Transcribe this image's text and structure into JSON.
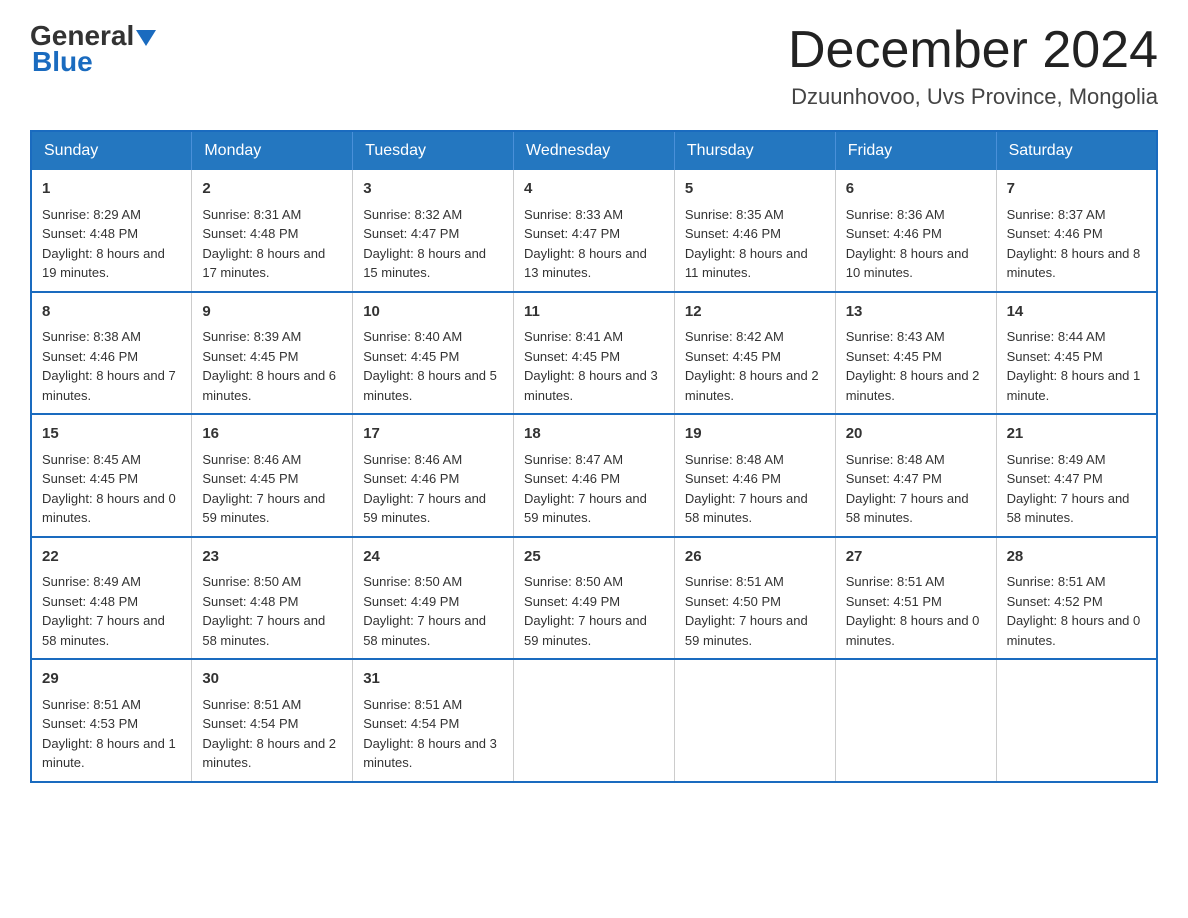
{
  "header": {
    "logo": {
      "general": "General",
      "blue": "Blue",
      "url_text": "GeneralBlue"
    },
    "title": "December 2024",
    "location": "Dzuunhovoo, Uvs Province, Mongolia"
  },
  "days_of_week": [
    "Sunday",
    "Monday",
    "Tuesday",
    "Wednesday",
    "Thursday",
    "Friday",
    "Saturday"
  ],
  "weeks": [
    [
      {
        "day": "1",
        "sunrise": "Sunrise: 8:29 AM",
        "sunset": "Sunset: 4:48 PM",
        "daylight": "Daylight: 8 hours and 19 minutes."
      },
      {
        "day": "2",
        "sunrise": "Sunrise: 8:31 AM",
        "sunset": "Sunset: 4:48 PM",
        "daylight": "Daylight: 8 hours and 17 minutes."
      },
      {
        "day": "3",
        "sunrise": "Sunrise: 8:32 AM",
        "sunset": "Sunset: 4:47 PM",
        "daylight": "Daylight: 8 hours and 15 minutes."
      },
      {
        "day": "4",
        "sunrise": "Sunrise: 8:33 AM",
        "sunset": "Sunset: 4:47 PM",
        "daylight": "Daylight: 8 hours and 13 minutes."
      },
      {
        "day": "5",
        "sunrise": "Sunrise: 8:35 AM",
        "sunset": "Sunset: 4:46 PM",
        "daylight": "Daylight: 8 hours and 11 minutes."
      },
      {
        "day": "6",
        "sunrise": "Sunrise: 8:36 AM",
        "sunset": "Sunset: 4:46 PM",
        "daylight": "Daylight: 8 hours and 10 minutes."
      },
      {
        "day": "7",
        "sunrise": "Sunrise: 8:37 AM",
        "sunset": "Sunset: 4:46 PM",
        "daylight": "Daylight: 8 hours and 8 minutes."
      }
    ],
    [
      {
        "day": "8",
        "sunrise": "Sunrise: 8:38 AM",
        "sunset": "Sunset: 4:46 PM",
        "daylight": "Daylight: 8 hours and 7 minutes."
      },
      {
        "day": "9",
        "sunrise": "Sunrise: 8:39 AM",
        "sunset": "Sunset: 4:45 PM",
        "daylight": "Daylight: 8 hours and 6 minutes."
      },
      {
        "day": "10",
        "sunrise": "Sunrise: 8:40 AM",
        "sunset": "Sunset: 4:45 PM",
        "daylight": "Daylight: 8 hours and 5 minutes."
      },
      {
        "day": "11",
        "sunrise": "Sunrise: 8:41 AM",
        "sunset": "Sunset: 4:45 PM",
        "daylight": "Daylight: 8 hours and 3 minutes."
      },
      {
        "day": "12",
        "sunrise": "Sunrise: 8:42 AM",
        "sunset": "Sunset: 4:45 PM",
        "daylight": "Daylight: 8 hours and 2 minutes."
      },
      {
        "day": "13",
        "sunrise": "Sunrise: 8:43 AM",
        "sunset": "Sunset: 4:45 PM",
        "daylight": "Daylight: 8 hours and 2 minutes."
      },
      {
        "day": "14",
        "sunrise": "Sunrise: 8:44 AM",
        "sunset": "Sunset: 4:45 PM",
        "daylight": "Daylight: 8 hours and 1 minute."
      }
    ],
    [
      {
        "day": "15",
        "sunrise": "Sunrise: 8:45 AM",
        "sunset": "Sunset: 4:45 PM",
        "daylight": "Daylight: 8 hours and 0 minutes."
      },
      {
        "day": "16",
        "sunrise": "Sunrise: 8:46 AM",
        "sunset": "Sunset: 4:45 PM",
        "daylight": "Daylight: 7 hours and 59 minutes."
      },
      {
        "day": "17",
        "sunrise": "Sunrise: 8:46 AM",
        "sunset": "Sunset: 4:46 PM",
        "daylight": "Daylight: 7 hours and 59 minutes."
      },
      {
        "day": "18",
        "sunrise": "Sunrise: 8:47 AM",
        "sunset": "Sunset: 4:46 PM",
        "daylight": "Daylight: 7 hours and 59 minutes."
      },
      {
        "day": "19",
        "sunrise": "Sunrise: 8:48 AM",
        "sunset": "Sunset: 4:46 PM",
        "daylight": "Daylight: 7 hours and 58 minutes."
      },
      {
        "day": "20",
        "sunrise": "Sunrise: 8:48 AM",
        "sunset": "Sunset: 4:47 PM",
        "daylight": "Daylight: 7 hours and 58 minutes."
      },
      {
        "day": "21",
        "sunrise": "Sunrise: 8:49 AM",
        "sunset": "Sunset: 4:47 PM",
        "daylight": "Daylight: 7 hours and 58 minutes."
      }
    ],
    [
      {
        "day": "22",
        "sunrise": "Sunrise: 8:49 AM",
        "sunset": "Sunset: 4:48 PM",
        "daylight": "Daylight: 7 hours and 58 minutes."
      },
      {
        "day": "23",
        "sunrise": "Sunrise: 8:50 AM",
        "sunset": "Sunset: 4:48 PM",
        "daylight": "Daylight: 7 hours and 58 minutes."
      },
      {
        "day": "24",
        "sunrise": "Sunrise: 8:50 AM",
        "sunset": "Sunset: 4:49 PM",
        "daylight": "Daylight: 7 hours and 58 minutes."
      },
      {
        "day": "25",
        "sunrise": "Sunrise: 8:50 AM",
        "sunset": "Sunset: 4:49 PM",
        "daylight": "Daylight: 7 hours and 59 minutes."
      },
      {
        "day": "26",
        "sunrise": "Sunrise: 8:51 AM",
        "sunset": "Sunset: 4:50 PM",
        "daylight": "Daylight: 7 hours and 59 minutes."
      },
      {
        "day": "27",
        "sunrise": "Sunrise: 8:51 AM",
        "sunset": "Sunset: 4:51 PM",
        "daylight": "Daylight: 8 hours and 0 minutes."
      },
      {
        "day": "28",
        "sunrise": "Sunrise: 8:51 AM",
        "sunset": "Sunset: 4:52 PM",
        "daylight": "Daylight: 8 hours and 0 minutes."
      }
    ],
    [
      {
        "day": "29",
        "sunrise": "Sunrise: 8:51 AM",
        "sunset": "Sunset: 4:53 PM",
        "daylight": "Daylight: 8 hours and 1 minute."
      },
      {
        "day": "30",
        "sunrise": "Sunrise: 8:51 AM",
        "sunset": "Sunset: 4:54 PM",
        "daylight": "Daylight: 8 hours and 2 minutes."
      },
      {
        "day": "31",
        "sunrise": "Sunrise: 8:51 AM",
        "sunset": "Sunset: 4:54 PM",
        "daylight": "Daylight: 8 hours and 3 minutes."
      },
      null,
      null,
      null,
      null
    ]
  ]
}
